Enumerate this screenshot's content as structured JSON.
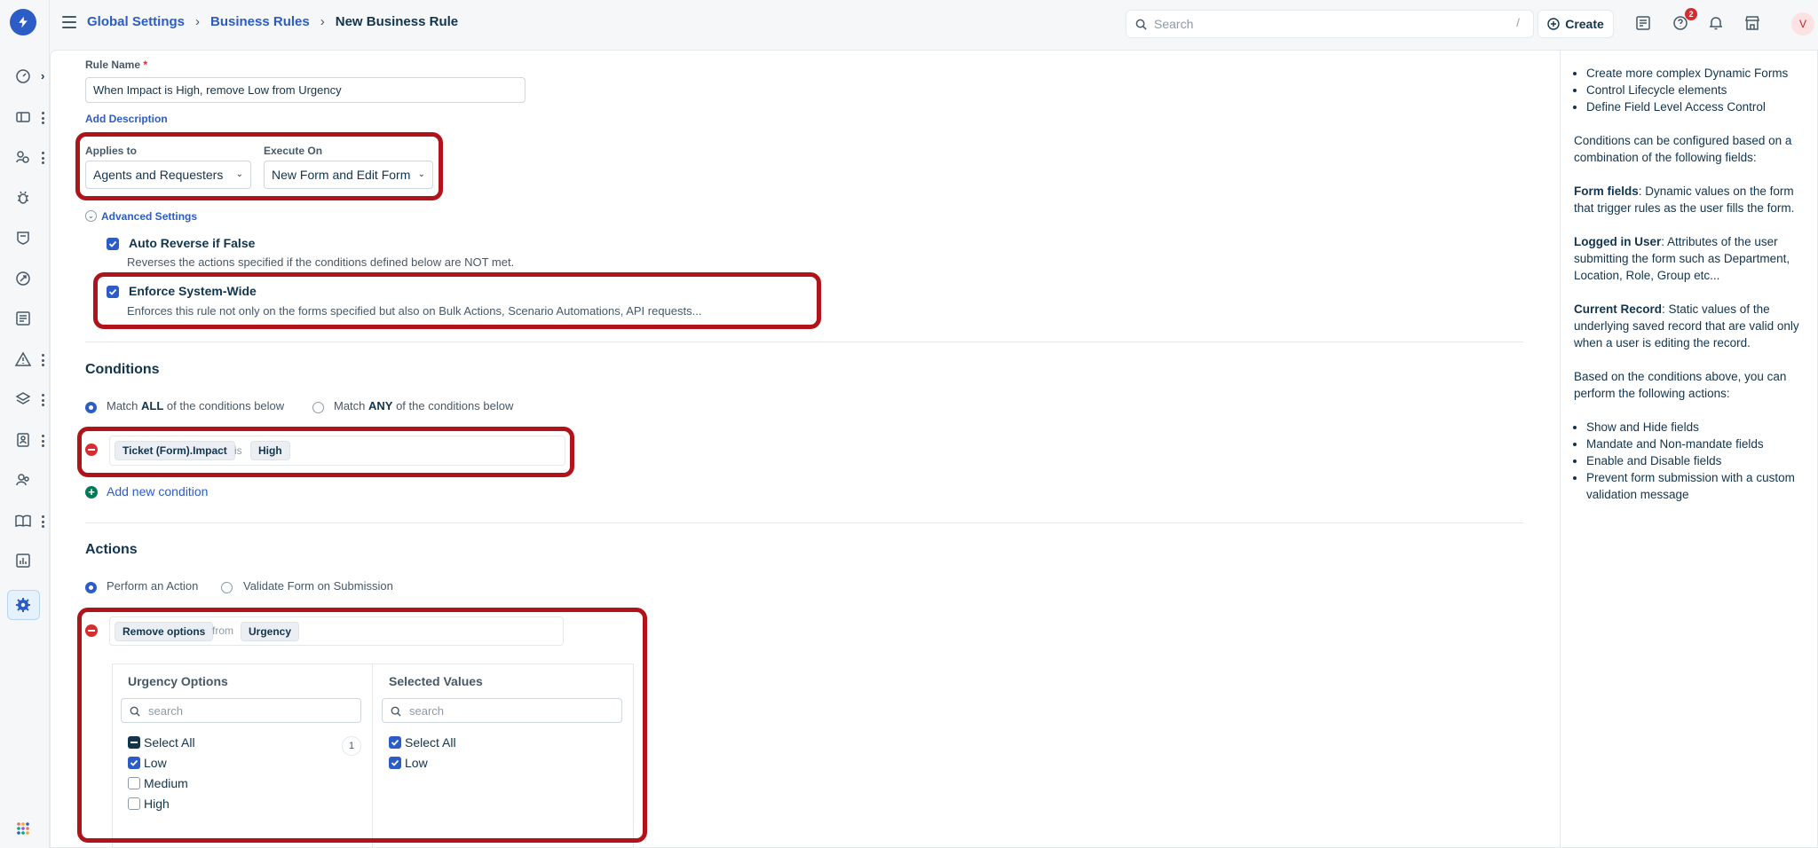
{
  "breadcrumb": {
    "items": [
      "Global Settings",
      "Business Rules",
      "New Business Rule"
    ]
  },
  "topbar": {
    "search_placeholder": "Search",
    "search_shortcut": "/",
    "create_label": "Create",
    "help_badge": "2",
    "avatar_initial": "V"
  },
  "form": {
    "rule_name_label": "Rule Name",
    "rule_name_required": "*",
    "rule_name_value": "When Impact is High, remove Low from Urgency",
    "add_description": "Add Description",
    "applies_to_label": "Applies to",
    "applies_to_value": "Agents and Requesters",
    "execute_on_label": "Execute On",
    "execute_on_value": "New Form and Edit Form",
    "advanced_settings": "Advanced Settings",
    "auto_reverse_title": "Auto Reverse if False",
    "auto_reverse_desc": "Reverses the actions specified if the conditions defined below are NOT met.",
    "enforce_title": "Enforce System-Wide",
    "enforce_desc": "Enforces this rule not only on the forms specified but also on Bulk Actions, Scenario Automations, API requests..."
  },
  "conditions": {
    "heading": "Conditions",
    "match_all_pre": "Match ",
    "match_all_bold": "ALL",
    "match_all_post": " of the conditions below",
    "match_any_pre": "Match ",
    "match_any_bold": "ANY",
    "match_any_post": " of the conditions below",
    "field": "Ticket (Form).Impact",
    "operator": "is",
    "value": "High",
    "add_new": "Add new condition"
  },
  "actions": {
    "heading": "Actions",
    "perform": "Perform an Action",
    "validate": "Validate Form on Submission",
    "action": "Remove options",
    "keyword": "from",
    "target": "Urgency",
    "left_title": "Urgency Options",
    "left_search": "search",
    "left_select_all": "Select All",
    "left_count": "1",
    "left_options": [
      {
        "label": "Low",
        "checked": true
      },
      {
        "label": "Medium",
        "checked": false
      },
      {
        "label": "High",
        "checked": false
      }
    ],
    "right_title": "Selected Values",
    "right_search": "search",
    "right_select_all": "Select All",
    "right_options": [
      {
        "label": "Low",
        "checked": true
      }
    ]
  },
  "help": {
    "bullets1": [
      "Create more complex Dynamic Forms",
      "Control Lifecycle elements",
      "Define Field Level Access Control"
    ],
    "intro": "Conditions can be configured based on a combination of the following fields:",
    "form_fields_term": "Form fields",
    "form_fields_desc": ": Dynamic values on the form that trigger rules as the user fills the form.",
    "logged_term": "Logged in User",
    "logged_desc": ": Attributes of the user submitting the form such as Department, Location, Role, Group etc...",
    "record_term": "Current Record",
    "record_desc": ": Static values of the underlying saved record that are valid only when a user is editing the record.",
    "actions_intro": "Based on the conditions above, you can perform the following actions:",
    "bullets2": [
      "Show and Hide fields",
      "Mandate and Non-mandate fields",
      "Enable and Disable fields",
      "Prevent form submission with a custom validation message"
    ]
  },
  "colors": {
    "accent": "#2c5cc5",
    "highlight_border": "#b0141a",
    "remove": "#d72d30",
    "add": "#00795b"
  }
}
